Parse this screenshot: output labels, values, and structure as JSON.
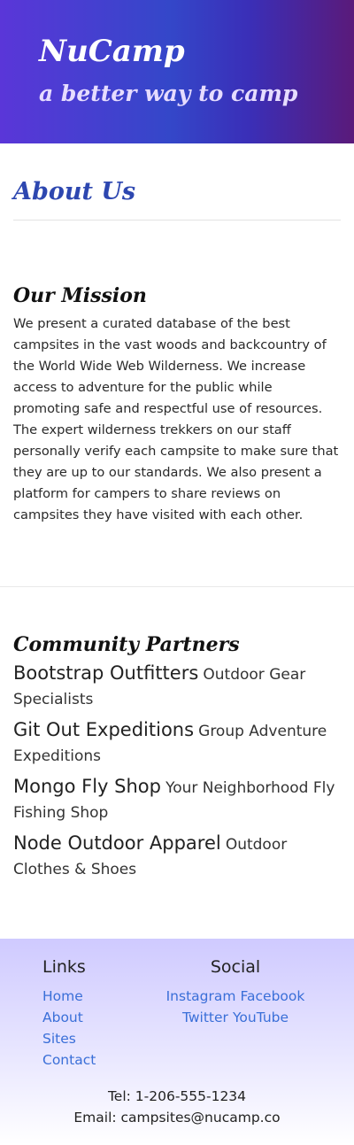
{
  "header": {
    "brand": "NuCamp",
    "tagline": "a better way to camp"
  },
  "about": {
    "title": "About Us"
  },
  "mission": {
    "title": "Our Mission",
    "text": "We present a curated database of the best campsites in the vast woods and backcountry of the World Wide Web Wilderness. We increase access to adventure for the public while promoting safe and respectful use of resources. The expert wilderness trekkers on our staff personally verify each campsite to make sure that they are up to our standards. We also present a platform for campers to share reviews on campsites they have visited with each other."
  },
  "partners": {
    "title": "Community Partners",
    "items": [
      {
        "name": "Bootstrap Outfitters",
        "desc": "Outdoor Gear Specialists"
      },
      {
        "name": "Git Out Expeditions",
        "desc": "Group Adventure Expeditions"
      },
      {
        "name": "Mongo Fly Shop",
        "desc": "Your Neighborhood Fly Fishing Shop"
      },
      {
        "name": "Node Outdoor Apparel",
        "desc": "Outdoor Clothes & Shoes"
      }
    ]
  },
  "footer": {
    "links_title": "Links",
    "links": [
      "Home",
      "About",
      "Sites",
      "Contact"
    ],
    "social_title": "Social",
    "social": [
      "Instagram",
      "Facebook",
      "Twitter",
      "YouTube"
    ],
    "tel": "Tel: 1-206-555-1234",
    "email": "Email: campsites@nucamp.co"
  }
}
